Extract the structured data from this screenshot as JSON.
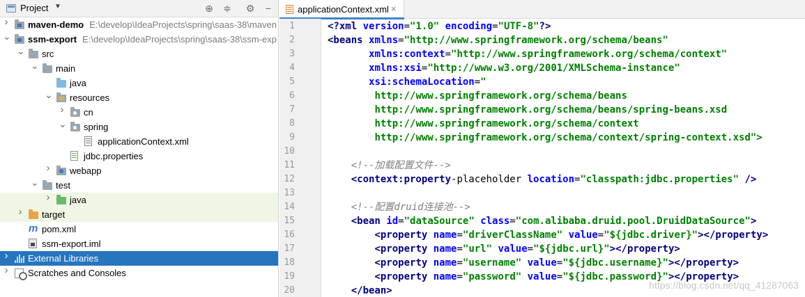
{
  "project_panel": {
    "title": "Project",
    "icons": {
      "target": "crosshair-icon",
      "collapse": "collapse-all-icon",
      "settings": "gear-icon",
      "hide": "minus-icon"
    }
  },
  "tree": [
    {
      "name": "maven-demo",
      "path": "E:\\develop\\IdeaProjects\\spring\\saas-38\\maven",
      "bold": true,
      "depth": 0,
      "arrow": "collapsed",
      "icon": "module-folder-icon"
    },
    {
      "name": "ssm-export",
      "path": "E:\\develop\\IdeaProjects\\spring\\saas-38\\ssm-exp",
      "bold": true,
      "depth": 0,
      "arrow": "expanded",
      "icon": "module-folder-icon"
    },
    {
      "name": "src",
      "depth": 1,
      "arrow": "expanded",
      "icon": "folder-icon"
    },
    {
      "name": "main",
      "depth": 2,
      "arrow": "expanded",
      "icon": "folder-icon"
    },
    {
      "name": "java",
      "depth": 3,
      "arrow": "none",
      "icon": "source-folder-icon"
    },
    {
      "name": "resources",
      "depth": 3,
      "arrow": "expanded",
      "icon": "resources-folder-icon"
    },
    {
      "name": "cn",
      "depth": 4,
      "arrow": "collapsed",
      "icon": "package-folder-icon"
    },
    {
      "name": "spring",
      "depth": 4,
      "arrow": "expanded",
      "icon": "package-folder-icon"
    },
    {
      "name": "applicationContext.xml",
      "depth": 5,
      "arrow": "none",
      "icon": "xml-file-icon"
    },
    {
      "name": "jdbc.properties",
      "depth": 4,
      "arrow": "none",
      "icon": "properties-file-icon"
    },
    {
      "name": "webapp",
      "depth": 3,
      "arrow": "collapsed",
      "icon": "web-folder-icon"
    },
    {
      "name": "test",
      "depth": 2,
      "arrow": "expanded",
      "icon": "folder-icon"
    },
    {
      "name": "java",
      "depth": 3,
      "arrow": "collapsed",
      "icon": "test-folder-icon",
      "highlight": "green"
    },
    {
      "name": "target",
      "depth": 1,
      "arrow": "collapsed",
      "icon": "excluded-folder-icon",
      "highlight": "green"
    },
    {
      "name": "pom.xml",
      "depth": 1,
      "arrow": "none",
      "icon": "maven-icon"
    },
    {
      "name": "ssm-export.iml",
      "depth": 1,
      "arrow": "none",
      "icon": "iml-file-icon"
    },
    {
      "name": "External Libraries",
      "depth": 0,
      "arrow": "collapsed",
      "icon": "libraries-icon",
      "selected": true
    },
    {
      "name": "Scratches and Consoles",
      "depth": 0,
      "arrow": "collapsed",
      "icon": "scratches-icon"
    }
  ],
  "editor": {
    "tab_label": "applicationContext.xml",
    "tab_close": "×",
    "lines": [
      "<?xml version=\"1.0\" encoding=\"UTF-8\"?>",
      "<beans xmlns=\"http://www.springframework.org/schema/beans\"",
      "       xmlns:context=\"http://www.springframework.org/schema/context\"",
      "       xmlns:xsi=\"http://www.w3.org/2001/XMLSchema-instance\"",
      "       xsi:schemaLocation=\"",
      "        http://www.springframework.org/schema/beans",
      "        http://www.springframework.org/schema/beans/spring-beans.xsd",
      "        http://www.springframework.org/schema/context",
      "        http://www.springframework.org/schema/context/spring-context.xsd\">",
      "",
      "    <!--加载配置文件-->",
      "    <context:property-placeholder location=\"classpath:jdbc.properties\" />",
      "",
      "    <!--配置druid连接池-->",
      "    <bean id=\"dataSource\" class=\"com.alibaba.druid.pool.DruidDataSource\">",
      "        <property name=\"driverClassName\" value=\"${jdbc.driver}\"></property>",
      "        <property name=\"url\" value=\"${jdbc.url}\"></property>",
      "        <property name=\"username\" value=\"${jdbc.username}\"></property>",
      "        <property name=\"password\" value=\"${jdbc.password}\"></property>",
      "    </bean>"
    ],
    "line_numbers": [
      "1",
      "2",
      "3",
      "4",
      "5",
      "6",
      "7",
      "8",
      "9",
      "10",
      "11",
      "12",
      "13",
      "14",
      "15",
      "16",
      "17",
      "18",
      "19",
      "20"
    ]
  },
  "watermark": "https://blog.csdn.net/qq_41287063"
}
